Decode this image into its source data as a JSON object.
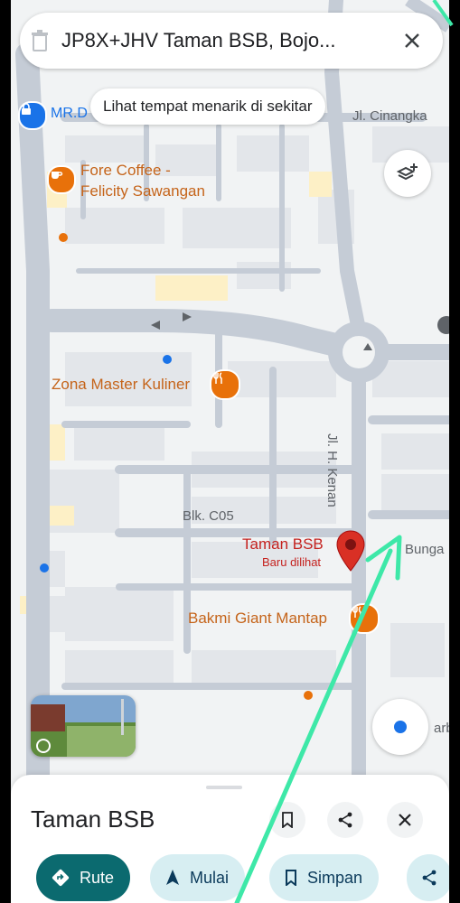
{
  "search": {
    "query": "JP8X+JHV Taman BSB, Bojo..."
  },
  "nearby_chip": "Lihat tempat menarik di sekitar",
  "map": {
    "labels": {
      "mr_d": "MR.D",
      "street_cinangka": "Jl. Cinangka",
      "fore_coffee_1": "Fore Coffee -",
      "fore_coffee_2": "Felicity Sawangan",
      "zona_master": "Zona Master Kuliner",
      "jl_kenan": "Jl. H. Kenan",
      "blk_c05": "Blk. C05",
      "taman_bsb": "Taman BSB",
      "baru_dilihat": "Baru dilihat",
      "bunga": "Bunga",
      "bakmi": "Bakmi Giant Mantap",
      "partial_right": "arb"
    }
  },
  "sheet": {
    "title": "Taman BSB",
    "buttons": {
      "rute": "Rute",
      "mulai": "Mulai",
      "simpan": "Simpan"
    }
  },
  "colors": {
    "accent_teal": "#0b6a6f",
    "chip_blue": "#d7eef2",
    "pin_red": "#d93025",
    "poi_orange": "#e8710a",
    "annotation_green": "#3ee8a8"
  }
}
